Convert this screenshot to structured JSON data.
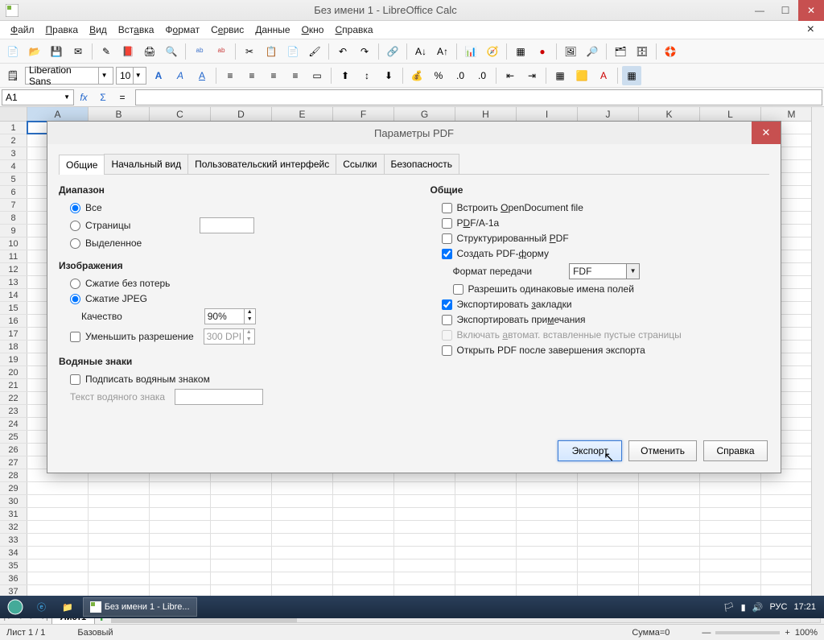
{
  "window": {
    "title": "Без имени 1 - LibreOffice Calc"
  },
  "menu": {
    "file": "Файл",
    "edit": "Правка",
    "view": "Вид",
    "insert": "Вставка",
    "format": "Формат",
    "tools": "Сервис",
    "data": "Данные",
    "window": "Окно",
    "help": "Справка"
  },
  "font": {
    "name": "Liberation Sans",
    "size": "10"
  },
  "cellref": "A1",
  "columns": [
    "A",
    "B",
    "C",
    "D",
    "E",
    "F",
    "G",
    "H",
    "I",
    "J",
    "K",
    "L",
    "M"
  ],
  "rows": [
    1,
    2,
    3,
    4,
    5,
    6,
    7,
    8,
    9,
    10,
    11,
    12,
    13,
    14,
    15,
    16,
    17,
    18,
    19,
    20,
    21,
    22,
    23,
    24,
    25,
    26,
    27,
    28,
    29,
    30,
    31,
    32,
    33,
    34,
    35,
    36,
    37
  ],
  "sheet_tab": "Лист1",
  "status": {
    "sheet": "Лист 1 / 1",
    "style": "Базовый",
    "sum": "Сумма=0",
    "zoom": "100%"
  },
  "dialog": {
    "title": "Параметры PDF",
    "tabs": {
      "general": "Общие",
      "initial": "Начальный вид",
      "ui": "Пользовательский интерфейс",
      "links": "Ссылки",
      "security": "Безопасность"
    },
    "range": {
      "title": "Диапазон",
      "all": "Все",
      "pages": "Страницы",
      "selection": "Выделенное"
    },
    "images": {
      "title": "Изображения",
      "lossless": "Сжатие без потерь",
      "jpeg": "Сжатие JPEG",
      "quality_label": "Качество",
      "quality": "90%",
      "reduce": "Уменьшить разрешение",
      "dpi": "300 DPI"
    },
    "watermark": {
      "title": "Водяные знаки",
      "sign": "Подписать водяным знаком",
      "text_label": "Текст водяного знака"
    },
    "general": {
      "title": "Общие",
      "embed": "Встроить OpenDocument file",
      "pdfa": "PDF/A-1a",
      "tagged": "Структурированный PDF",
      "form": "Создать PDF-форму",
      "submit_label": "Формат передачи",
      "submit_value": "FDF",
      "dup": "Разрешить одинаковые имена полей",
      "bookmarks": "Экспортировать закладки",
      "comments": "Экспортировать примечания",
      "blank": "Включать автомат. вставленные пустые страницы",
      "view": "Открыть PDF после завершения экспорта"
    },
    "buttons": {
      "export": "Экспорт",
      "cancel": "Отменить",
      "help": "Справка"
    }
  },
  "taskbar": {
    "app": "Без имени 1 - Libre...",
    "lang": "РУС",
    "time": "17:21"
  }
}
